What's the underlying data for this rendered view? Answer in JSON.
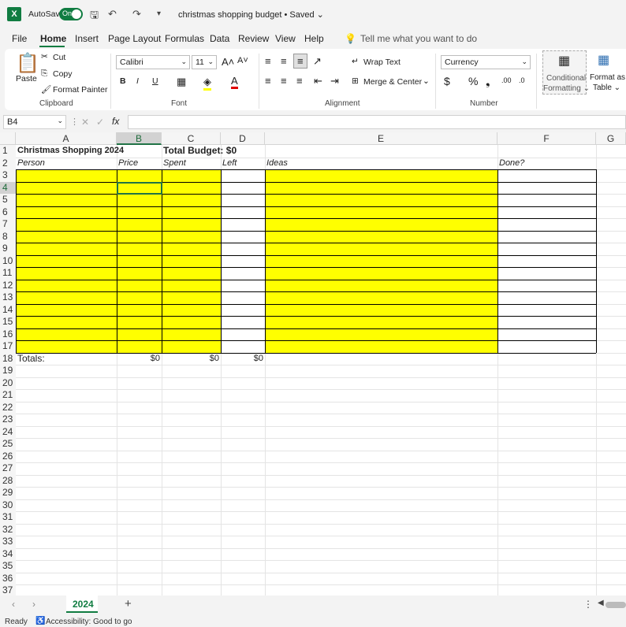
{
  "titlebar": {
    "app_icon": "X",
    "autosave_label": "AutoSave",
    "autosave_state": "On",
    "doc_title": "christmas shopping budget • Saved ⌄"
  },
  "menu": {
    "items": [
      "File",
      "Home",
      "Insert",
      "Page Layout",
      "Formulas",
      "Data",
      "Review",
      "View",
      "Help"
    ],
    "tell_me": "Tell me what you want to do"
  },
  "ribbon": {
    "clipboard": {
      "paste": "Paste",
      "cut": "Cut",
      "copy": "Copy",
      "format_painter": "Format Painter",
      "label": "Clipboard"
    },
    "font": {
      "family": "Calibri",
      "size": "11",
      "label": "Font",
      "bold": "B",
      "italic": "I",
      "underline": "U"
    },
    "alignment": {
      "wrap_text": "Wrap Text",
      "merge_center": "Merge & Center",
      "label": "Alignment"
    },
    "number": {
      "format": "Currency",
      "label": "Number",
      "dollar": "$",
      "percent": "%",
      "comma": "❟"
    },
    "styles": {
      "conditional_formatting_1": "Conditional",
      "conditional_formatting_2": "Formatting ⌄",
      "format_as_table_1": "Format as",
      "format_as_table_2": "Table ⌄"
    }
  },
  "formula_bar": {
    "name_box": "B4",
    "fx": "fx",
    "formula": ""
  },
  "sheet": {
    "columns": [
      "A",
      "B",
      "C",
      "D",
      "E",
      "F",
      "G"
    ],
    "selected_column": "B",
    "selected_row": "4",
    "rows": [
      "1",
      "2",
      "3",
      "4",
      "5",
      "6",
      "7",
      "8",
      "9",
      "10",
      "11",
      "12",
      "13",
      "14",
      "15",
      "16",
      "17",
      "18",
      "19",
      "20",
      "21",
      "22",
      "23",
      "24",
      "25",
      "26",
      "27",
      "28",
      "29",
      "30",
      "31",
      "32",
      "33",
      "34",
      "35",
      "36",
      "37"
    ],
    "cells": {
      "A1": "Christmas Shopping 2024",
      "C1": "Total Budget: $0",
      "A2": "Person",
      "B2": "Price",
      "C2": "Spent",
      "D2": "Left",
      "E2": "Ideas",
      "F2": "Done?",
      "A18": "Totals:",
      "B18": "$0",
      "C18": "$0",
      "D18": "$0"
    }
  },
  "tabs": {
    "sheet_tab": "2024",
    "add": "+"
  },
  "status": {
    "ready": "Ready",
    "accessibility": "Accessibility: Good to go"
  },
  "colors": {
    "accent": "#107c41",
    "highlight": "#ffff00"
  }
}
